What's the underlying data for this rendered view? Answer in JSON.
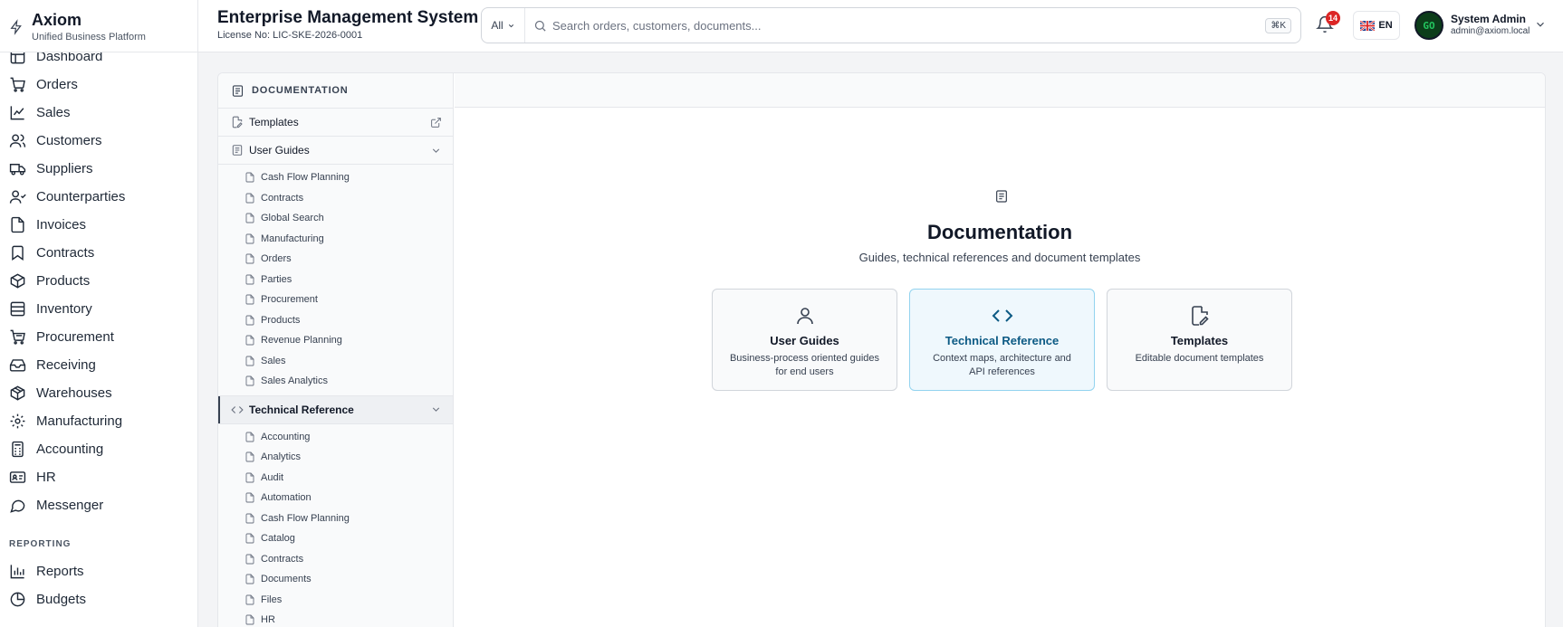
{
  "brand": {
    "title": "Axiom",
    "subtitle": "Unified Business Platform"
  },
  "sidebar": {
    "items": [
      {
        "label": "Dashboard",
        "icon": "dashboard-icon"
      },
      {
        "label": "Orders",
        "icon": "cart-icon"
      },
      {
        "label": "Sales",
        "icon": "trend-icon"
      },
      {
        "label": "Customers",
        "icon": "users-icon"
      },
      {
        "label": "Suppliers",
        "icon": "truck-icon"
      },
      {
        "label": "Counterparties",
        "icon": "people-icon"
      },
      {
        "label": "Invoices",
        "icon": "file-icon"
      },
      {
        "label": "Contracts",
        "icon": "bookmark-icon"
      },
      {
        "label": "Products",
        "icon": "box-icon"
      },
      {
        "label": "Inventory",
        "icon": "database-icon"
      },
      {
        "label": "Procurement",
        "icon": "shopping-cart-icon"
      },
      {
        "label": "Receiving",
        "icon": "inbox-icon"
      },
      {
        "label": "Warehouses",
        "icon": "package-icon"
      },
      {
        "label": "Manufacturing",
        "icon": "cog-icon"
      },
      {
        "label": "Accounting",
        "icon": "calculator-icon"
      },
      {
        "label": "HR",
        "icon": "id-card-icon"
      },
      {
        "label": "Messenger",
        "icon": "chat-icon"
      }
    ],
    "reporting_section": "REPORTING",
    "reporting_items": [
      {
        "label": "Reports",
        "icon": "bar-chart-icon"
      },
      {
        "label": "Budgets",
        "icon": "pie-icon"
      }
    ]
  },
  "header": {
    "title": "Enterprise Management System",
    "license": "License No: LIC-SKE-2026-0001",
    "search": {
      "scope": "All",
      "placeholder": "Search orders, customers, documents...",
      "shortcut": "⌘K"
    },
    "notifications_count": "14",
    "language": "EN",
    "user": {
      "initials": "GO",
      "name": "System Admin",
      "email": "admin@axiom.local"
    }
  },
  "docs": {
    "section_title": "DOCUMENTATION",
    "templates_label": "Templates",
    "user_guides": {
      "label": "User Guides",
      "items": [
        "Cash Flow Planning",
        "Contracts",
        "Global Search",
        "Manufacturing",
        "Orders",
        "Parties",
        "Procurement",
        "Products",
        "Revenue Planning",
        "Sales",
        "Sales Analytics"
      ]
    },
    "technical_reference": {
      "label": "Technical Reference",
      "items": [
        "Accounting",
        "Analytics",
        "Audit",
        "Automation",
        "Cash Flow Planning",
        "Catalog",
        "Contracts",
        "Documents",
        "Files",
        "HR"
      ]
    }
  },
  "main": {
    "title": "Documentation",
    "subtitle": "Guides, technical references and document templates",
    "cards": [
      {
        "title": "User Guides",
        "description": "Business-process oriented guides for end users",
        "icon": "user-icon"
      },
      {
        "title": "Technical Reference",
        "description": "Context maps, architecture and API references",
        "icon": "code-icon"
      },
      {
        "title": "Templates",
        "description": "Editable document templates",
        "icon": "file-edit-icon"
      }
    ]
  },
  "colors": {
    "accent": "#0c5a84",
    "badge": "#dc2626",
    "highlight_bg": "#eff8fd"
  }
}
